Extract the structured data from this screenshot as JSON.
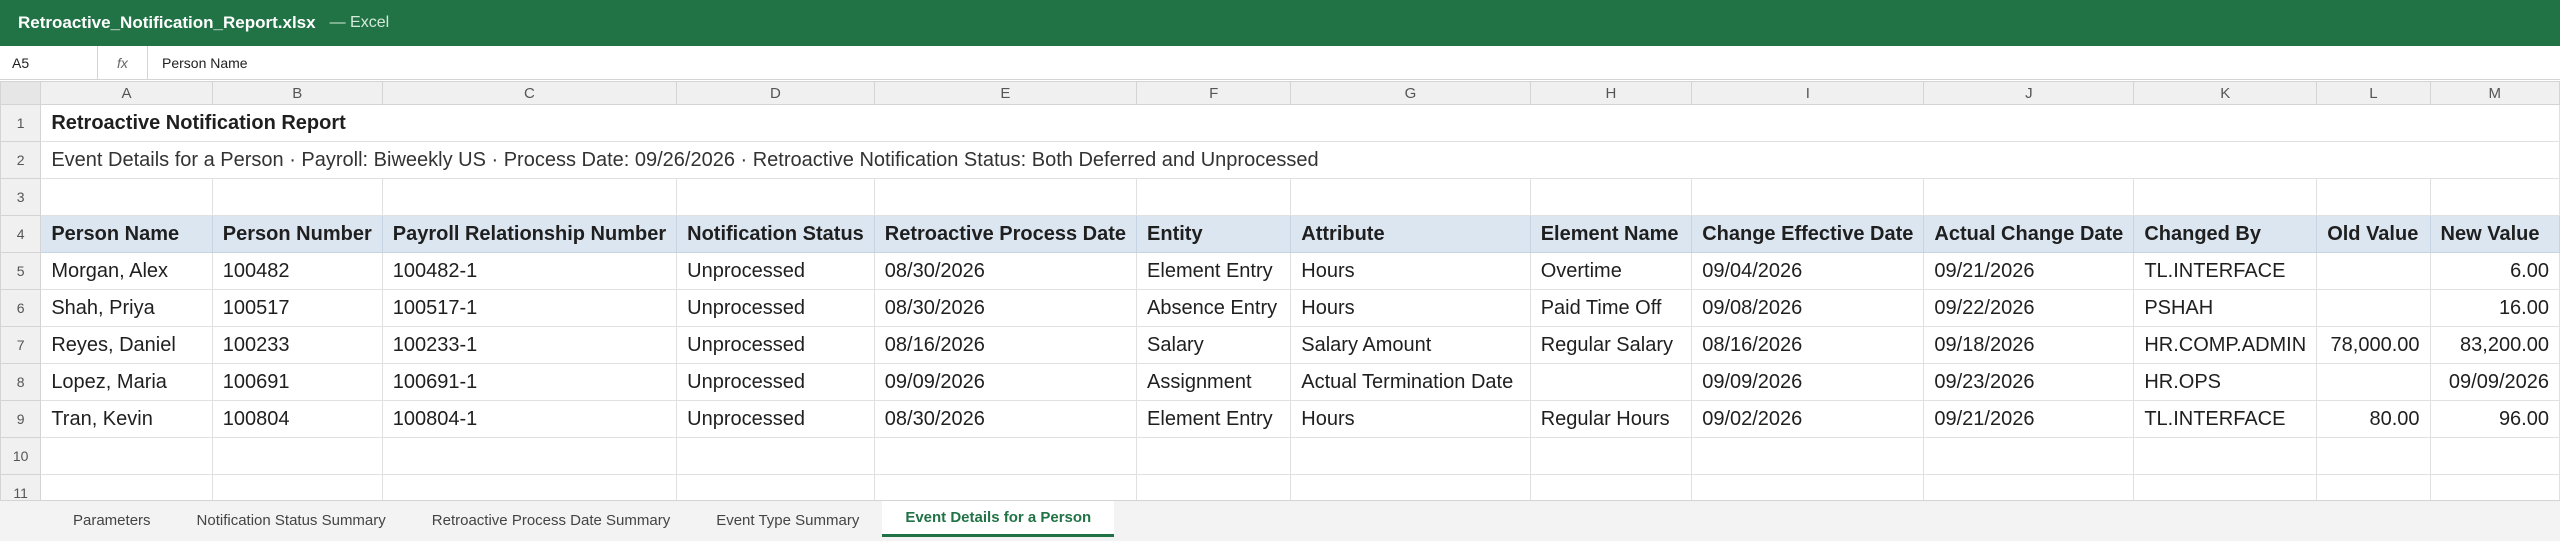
{
  "window": {
    "file_name": "Retroactive_Notification_Report.xlsx",
    "app_suffix": "— Excel"
  },
  "formula_bar": {
    "cell_ref": "A5",
    "fx_label": "fx",
    "value": "Person Name"
  },
  "columns": [
    "A",
    "B",
    "C",
    "D",
    "E",
    "F",
    "G",
    "H",
    "I",
    "J",
    "K",
    "L",
    "M"
  ],
  "rows": {
    "r1": {
      "num": "1",
      "title": "Retroactive Notification Report"
    },
    "r2": {
      "num": "2",
      "subtitle": "Event Details for a Person  ·  Payroll: Biweekly US  ·  Process Date: 09/26/2026  ·  Retroactive Notification Status: Both Deferred and Unprocessed"
    },
    "r3": {
      "num": "3"
    },
    "r4": {
      "num": "4",
      "headers": [
        "Person Name",
        "Person Number",
        "Payroll Relationship Number",
        "Notification Status",
        "Retroactive Process Date",
        "Entity",
        "Attribute",
        "Element Name",
        "Change Effective Date",
        "Actual Change Date",
        "Changed By",
        "Old Value",
        "New Value"
      ]
    },
    "data": [
      {
        "num": "5",
        "cells": [
          "Morgan, Alex",
          "100482",
          "100482-1",
          "Unprocessed",
          "08/30/2026",
          "Element Entry",
          "Hours",
          "Overtime",
          "09/04/2026",
          "09/21/2026",
          "TL.INTERFACE",
          "",
          "6.00"
        ]
      },
      {
        "num": "6",
        "cells": [
          "Shah, Priya",
          "100517",
          "100517-1",
          "Unprocessed",
          "08/30/2026",
          "Absence Entry",
          "Hours",
          "Paid Time Off",
          "09/08/2026",
          "09/22/2026",
          "PSHAH",
          "",
          "16.00"
        ]
      },
      {
        "num": "7",
        "cells": [
          "Reyes, Daniel",
          "100233",
          "100233-1",
          "Unprocessed",
          "08/16/2026",
          "Salary",
          "Salary Amount",
          "Regular Salary",
          "08/16/2026",
          "09/18/2026",
          "HR.COMP.ADMIN",
          "78,000.00",
          "83,200.00"
        ]
      },
      {
        "num": "8",
        "cells": [
          "Lopez, Maria",
          "100691",
          "100691-1",
          "Unprocessed",
          "09/09/2026",
          "Assignment",
          "Actual Termination Date",
          "",
          "09/09/2026",
          "09/23/2026",
          "HR.OPS",
          "",
          "09/09/2026"
        ]
      },
      {
        "num": "9",
        "cells": [
          "Tran, Kevin",
          "100804",
          "100804-1",
          "Unprocessed",
          "08/30/2026",
          "Element Entry",
          "Hours",
          "Regular Hours",
          "09/02/2026",
          "09/21/2026",
          "TL.INTERFACE",
          "80.00",
          "96.00"
        ]
      }
    ],
    "r10": {
      "num": "10"
    },
    "r11": {
      "num": "11"
    }
  },
  "sheet_tabs": [
    "Parameters",
    "Notification Status Summary",
    "Retroactive Process Date Summary",
    "Event Type Summary",
    "Event Details for a Person"
  ],
  "active_tab": "Event Details for a Person",
  "accent_color": "#217346"
}
